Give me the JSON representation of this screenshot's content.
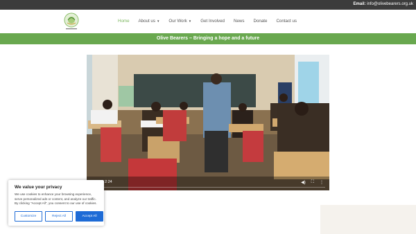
{
  "topbar": {
    "email_label": "Email:",
    "email_value": "info@olivebearers.org.uk"
  },
  "nav": {
    "items": [
      {
        "label": "Home",
        "has_dropdown": false,
        "active": true
      },
      {
        "label": "About us",
        "has_dropdown": true,
        "active": false
      },
      {
        "label": "Our Work",
        "has_dropdown": true,
        "active": false
      },
      {
        "label": "Get Involved",
        "has_dropdown": false,
        "active": false
      },
      {
        "label": "News",
        "has_dropdown": false,
        "active": false
      },
      {
        "label": "Donate",
        "has_dropdown": false,
        "active": false
      },
      {
        "label": "Contact us",
        "has_dropdown": false,
        "active": false
      }
    ]
  },
  "banner": {
    "title": "Olive Bearers – Bringing a hope and a future"
  },
  "video": {
    "time": "2:24",
    "icons": [
      "volume-icon",
      "fullscreen-icon",
      "more-options-icon"
    ]
  },
  "cookie": {
    "title": "We value your privacy",
    "body": "We use cookies to enhance your browsing experience, serve personalized ads or content, and analyze our traffic. By clicking \"Accept All\", you consent to our use of cookies.",
    "customize": "Customize",
    "reject": "Reject All",
    "accept": "Accept All"
  },
  "colors": {
    "brand_green": "#69a84f",
    "accent_blue": "#1e6bd6",
    "topbar": "#3c3c3c"
  }
}
